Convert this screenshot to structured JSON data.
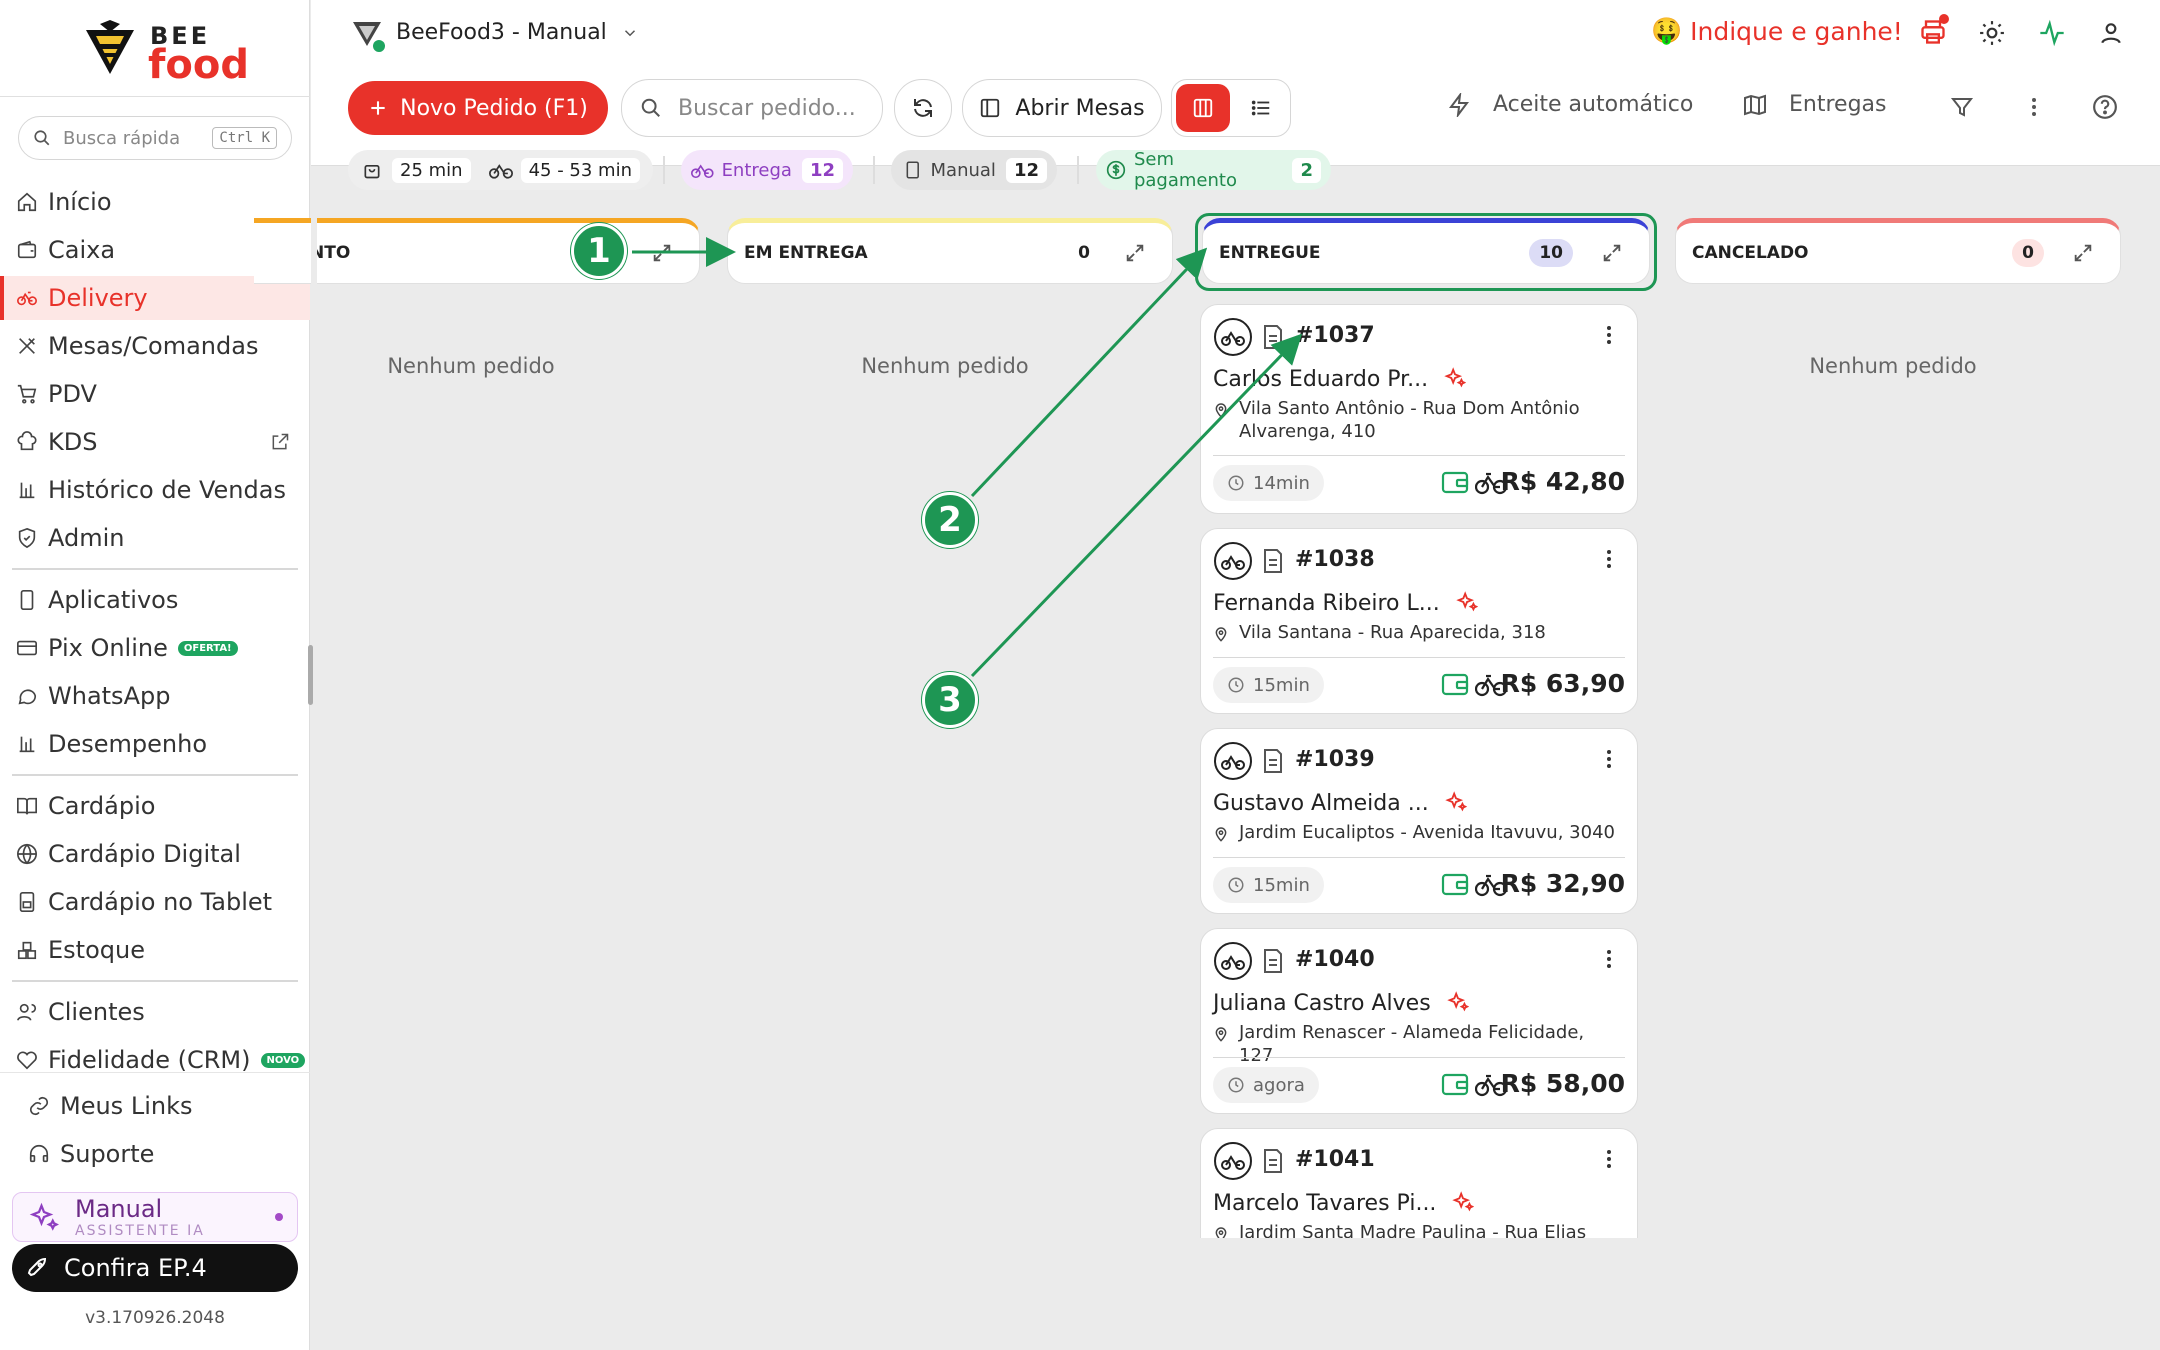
{
  "sidebar": {
    "brand_top": "BEE",
    "brand_bottom": "food",
    "search_placeholder": "Busca rápida",
    "search_shortcut": "Ctrl K",
    "items": [
      {
        "label": "Início",
        "icon": "home-icon"
      },
      {
        "label": "Caixa",
        "icon": "wallet-icon"
      },
      {
        "label": "Delivery",
        "icon": "bicycle-icon",
        "active": true
      },
      {
        "label": "Mesas/Comandas",
        "icon": "utensils-icon"
      },
      {
        "label": "PDV",
        "icon": "cart-icon"
      },
      {
        "label": "KDS",
        "icon": "chef-hat-icon"
      },
      {
        "label": "Histórico de Vendas",
        "icon": "bar-chart-icon"
      },
      {
        "label": "Admin",
        "icon": "shield-icon"
      },
      {
        "label": "Aplicativos",
        "icon": "phone-icon"
      },
      {
        "label": "Pix Online",
        "icon": "card-icon",
        "badge": "OFERTA!"
      },
      {
        "label": "WhatsApp",
        "icon": "chat-icon"
      },
      {
        "label": "Desempenho",
        "icon": "bar-chart-icon"
      },
      {
        "label": "Cardápio",
        "icon": "book-icon"
      },
      {
        "label": "Cardápio Digital",
        "icon": "globe-icon"
      },
      {
        "label": "Cardápio no Tablet",
        "icon": "tablet-icon"
      },
      {
        "label": "Estoque",
        "icon": "boxes-icon"
      },
      {
        "label": "Clientes",
        "icon": "users-icon"
      },
      {
        "label": "Fidelidade (CRM)",
        "icon": "heart-icon",
        "badge": "NOVO"
      },
      {
        "label": "Meus Links",
        "icon": "link-icon"
      },
      {
        "label": "Suporte",
        "icon": "headset-icon"
      }
    ],
    "assistant_name": "Manual",
    "assistant_sub": "ASSISTENTE IA",
    "confira": "Confira EP.4",
    "version": "v3.170926.2048"
  },
  "topbar": {
    "store": "BeeFood3 - Manual",
    "promo": "Indique e ganhe!",
    "promo_emoji": "🤑"
  },
  "toolbar": {
    "new_order": "Novo Pedido (F1)",
    "search_placeholder": "Buscar pedido...",
    "open_tables": "Abrir Mesas",
    "auto_accept": "Aceite automático",
    "deliveries": "Entregas",
    "prep_time": "25 min",
    "delivery_time": "45 - 53 min",
    "filters": [
      {
        "label": "Entrega",
        "count": "12"
      },
      {
        "label": "Manual",
        "count": "12"
      },
      {
        "label": "Sem pagamento",
        "count": "2"
      }
    ]
  },
  "columns": [
    {
      "title": "NTO",
      "count": "",
      "empty": "Nenhum pedido"
    },
    {
      "title": "EM ENTREGA",
      "count": "0",
      "empty": "Nenhum pedido"
    },
    {
      "title": "ENTREGUE",
      "count": "10",
      "empty": ""
    },
    {
      "title": "CANCELADO",
      "count": "0",
      "empty": "Nenhum pedido"
    }
  ],
  "orders": [
    {
      "id": "#1037",
      "name": "Carlos Eduardo Pr...",
      "address": "Vila Santo Antônio - Rua Dom Antônio Alvarenga, 410",
      "time": "14min",
      "price": "R$ 42,80"
    },
    {
      "id": "#1038",
      "name": "Fernanda Ribeiro L...",
      "address": "Vila Santana - Rua Aparecida, 318",
      "time": "15min",
      "price": "R$ 63,90"
    },
    {
      "id": "#1039",
      "name": "Gustavo Almeida ...",
      "address": "Jardim Eucaliptos - Avenida Itavuvu, 3040",
      "time": "15min",
      "price": "R$ 32,90"
    },
    {
      "id": "#1040",
      "name": "Juliana Castro Alves",
      "address": "Jardim Renascer - Alameda Felicidade, 127",
      "time": "agora",
      "price": "R$ 58,00"
    },
    {
      "id": "#1041",
      "name": "Marcelo Tavares Pi...",
      "address": "Jardim Santa Madre Paulina - Rua Elias",
      "time": "",
      "price": ""
    }
  ],
  "annotations": [
    "1",
    "2",
    "3"
  ],
  "colors": {
    "brand": "#e8322a",
    "annotation": "#1e9654",
    "purple": "#8e3fc1"
  }
}
